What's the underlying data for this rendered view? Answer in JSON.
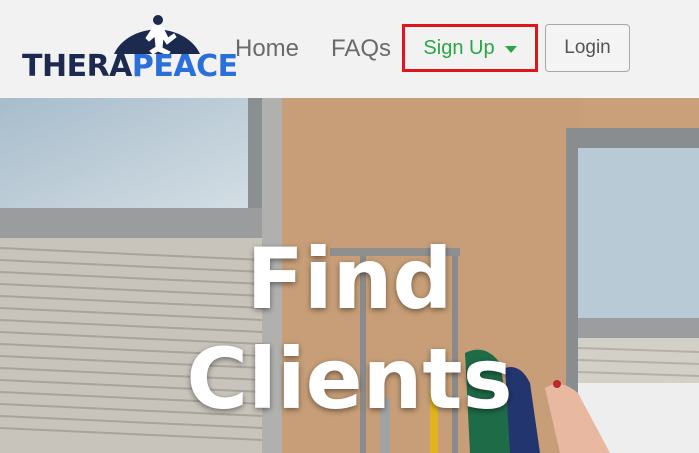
{
  "brand": {
    "part1": "THERA",
    "part2": "PEACE"
  },
  "nav": {
    "home": "Home",
    "faqs": "FAQs",
    "signup": "Sign Up",
    "login": "Login"
  },
  "hero": {
    "title_line1": "Find",
    "title_line2": "Clients"
  },
  "colors": {
    "signup_text": "#28a745",
    "signup_highlight_border": "#e0141c",
    "brand_dark": "#1d2a50",
    "brand_blue": "#2a6fdb"
  }
}
